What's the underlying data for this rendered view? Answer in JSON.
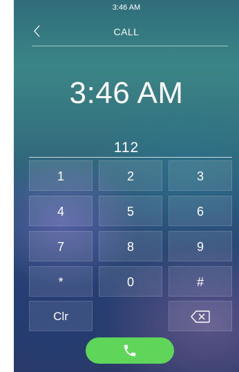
{
  "status_bar": {
    "time": "3:46 AM"
  },
  "header": {
    "title": "CALL",
    "back_icon": "chevron-left-icon"
  },
  "clock": {
    "time": "3:46 AM"
  },
  "dial_input": {
    "value": "112"
  },
  "keypad": {
    "keys": [
      "1",
      "2",
      "3",
      "4",
      "5",
      "6",
      "7",
      "8",
      "9",
      "*",
      "0",
      "#"
    ],
    "clear_label": "Clr",
    "backspace_icon": "backspace-icon"
  },
  "call_button": {
    "icon": "phone-icon",
    "color": "#5fd55a"
  },
  "colors": {
    "accent_green": "#5fd55a",
    "text": "#ffffff"
  }
}
